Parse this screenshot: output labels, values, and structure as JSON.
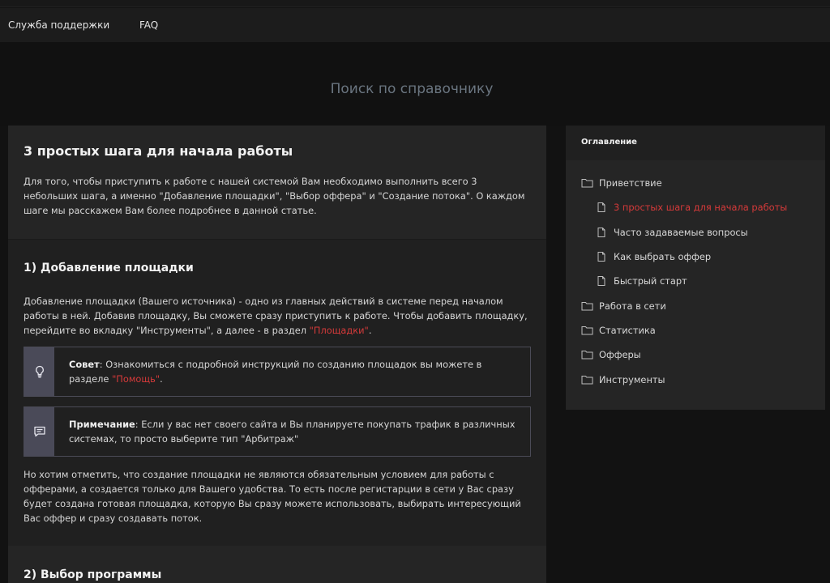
{
  "topnav": {
    "support": "Служба поддержки",
    "faq": "FAQ"
  },
  "search": {
    "placeholder": "Поиск по справочнику"
  },
  "article": {
    "title": "3 простых шага для начала работы",
    "intro": "Для того, чтобы приступить к работе с нашей системой Вам необходимо выполнить всего 3 небольших шага, а именно \"Добавление площадки\", \"Выбор оффера\" и \"Создание потока\". О каждом шаге мы расскажем Вам более подробнее в данной статье.",
    "step1": {
      "heading": "1) Добавление площадки",
      "text_before_link": "Добавление площадки (Вашего источника) - одно из главных действий в системе перед началом работы в ней. Добавив площадку, Вы сможете сразу приступить к работе. Чтобы добавить площадку, перейдите во вкладку \"Инструменты\", а далее - в раздел ",
      "link": "\"Площадки\"",
      "text_after_link": ".",
      "tip": {
        "label": "Совет",
        "text": ": Ознакомиться с подробной инструкций по созданию площадок вы можете в разделе ",
        "link": "\"Помощь\"",
        "end": "."
      },
      "note": {
        "label": "Примечание",
        "text": ": Если у вас нет своего сайта и Вы планируете покупать трафик в различных системах, то просто выберите тип \"Арбитраж\""
      },
      "after": "Но хотим отметить, что создание площадки не являются обязательным условием для работы с офферами, а создается только для Вашего удобства. То есть после регистарции в сети у Вас сразу будет создана готовая площадка, которую Вы сразу можете использовать, выбирать интересующий Вас оффер и сразу создавать поток."
    },
    "step2": {
      "heading": "2) Выбор программы"
    }
  },
  "toc": {
    "title": "Оглавление",
    "items": [
      {
        "label": "Приветствие",
        "icon": "folder-icon",
        "level": 1
      },
      {
        "label": "3 простых шага для начала работы",
        "icon": "document-icon",
        "level": 2,
        "active": true
      },
      {
        "label": "Часто задаваемые вопросы",
        "icon": "document-icon",
        "level": 2
      },
      {
        "label": "Как выбрать оффер",
        "icon": "document-icon",
        "level": 2
      },
      {
        "label": "Быстрый старт",
        "icon": "document-icon",
        "level": 2
      },
      {
        "label": "Работа в сети",
        "icon": "folder-icon",
        "level": 1
      },
      {
        "label": "Статистика",
        "icon": "folder-icon",
        "level": 1
      },
      {
        "label": "Офферы",
        "icon": "folder-icon",
        "level": 1
      },
      {
        "label": "Инструменты",
        "icon": "folder-icon",
        "level": 1
      }
    ]
  },
  "colors": {
    "accent_red": "#d63a3a",
    "callout_icon_bg": "#4a4a58"
  }
}
